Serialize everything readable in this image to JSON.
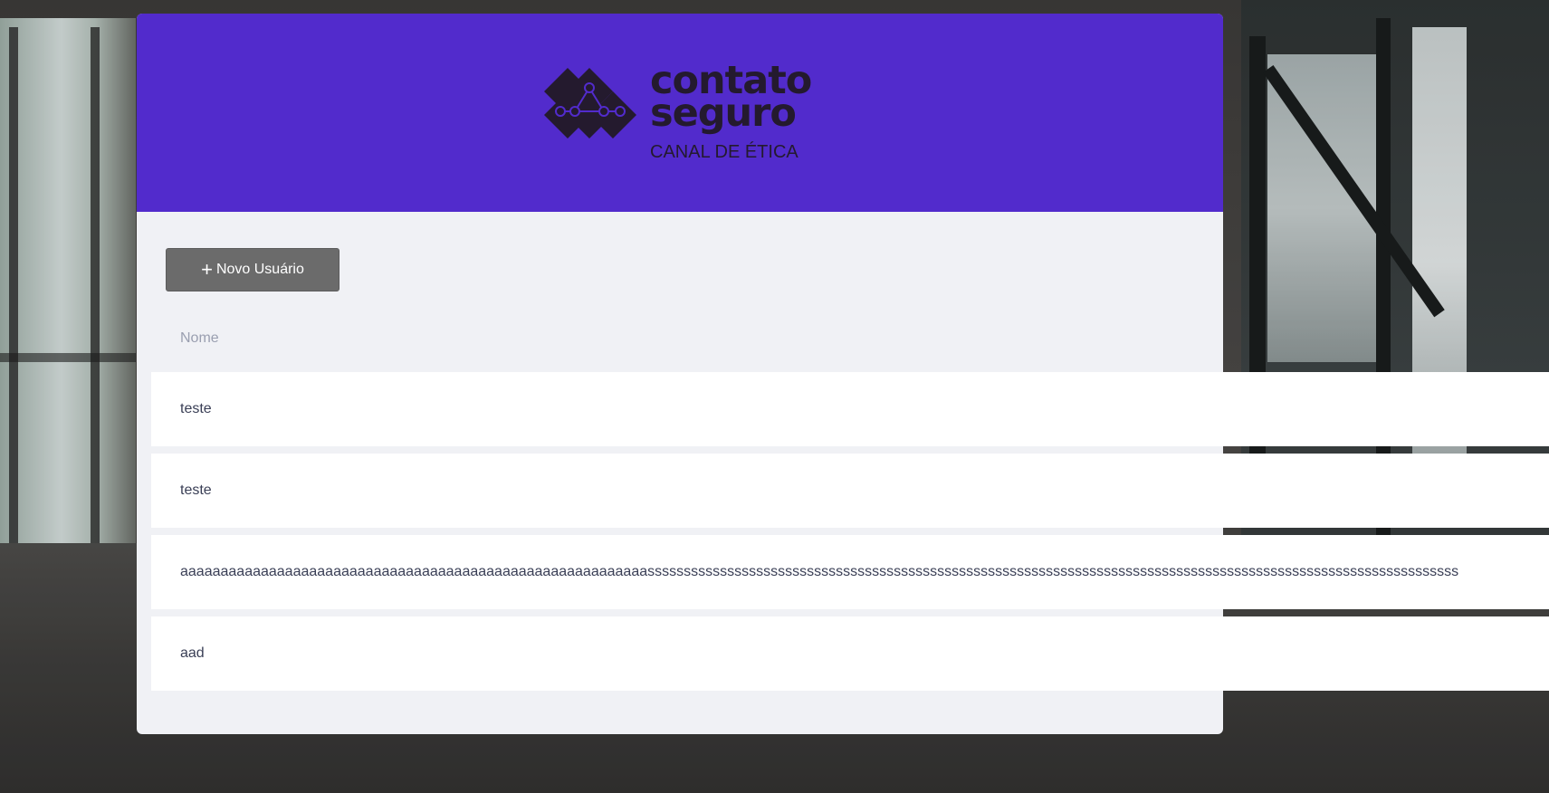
{
  "brand": {
    "name_line1": "contato",
    "name_line2": "seguro",
    "subtitle": "CANAL DE ÉTICA",
    "header_color": "#522bcc",
    "logo_color": "#241a2e"
  },
  "toolbar": {
    "new_user_icon": "+",
    "new_user_label": "Novo Usuário"
  },
  "table": {
    "columns": [
      "Nome"
    ],
    "rows": [
      {
        "name": "teste"
      },
      {
        "name": "teste"
      },
      {
        "name": "aaaaaaaaaaaaaaaaaaaaaaaaaaaaaaaaaaaaaaaaaaaaaaaaaaaaaaaaaassssssssssssssssssssssssssssssssssssssssssssssssssssssssssssssssssssssssssssssssssssssssssssssssssssssssssssssss"
      },
      {
        "name": "aad"
      }
    ]
  }
}
